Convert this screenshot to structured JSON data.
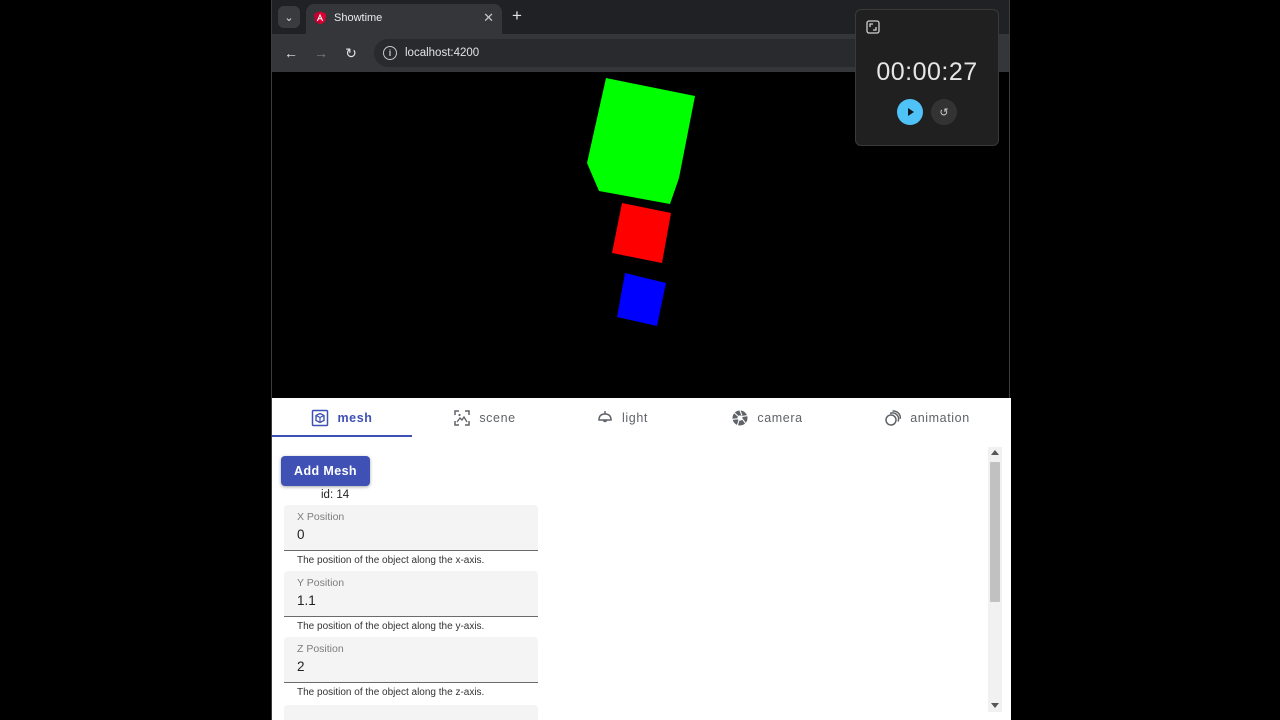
{
  "browser": {
    "tab_title": "Showtime",
    "tab_close": "✕",
    "new_tab": "+",
    "tab_menu": "⌄",
    "url": "localhost:4200",
    "back": "←",
    "forward": "→",
    "reload": "↻",
    "site_info": "i"
  },
  "scene": {
    "background": "#000000",
    "meshes": [
      {
        "color": "#00ff00",
        "name": "green-cube"
      },
      {
        "color": "#ff0000",
        "name": "red-cube"
      },
      {
        "color": "#0000ff",
        "name": "blue-cube"
      }
    ]
  },
  "panel": {
    "tabs": [
      {
        "label": "mesh",
        "icon": "cube-icon",
        "active": true
      },
      {
        "label": "scene",
        "icon": "image-frame-icon",
        "active": false
      },
      {
        "label": "light",
        "icon": "lamp-icon",
        "active": false
      },
      {
        "label": "camera",
        "icon": "camera-shutter-icon",
        "active": false
      },
      {
        "label": "animation",
        "icon": "animation-icon",
        "active": false
      }
    ],
    "accent": "#3f51b5",
    "add_mesh_label": "Add Mesh",
    "mesh_id": "id: 14",
    "fields": [
      {
        "label": "X Position",
        "value": "0",
        "hint": "The position of the object along the x-axis."
      },
      {
        "label": "Y Position",
        "value": "1.1",
        "hint": "The position of the object along the y-axis."
      },
      {
        "label": "Z Position",
        "value": "2",
        "hint": "The position of the object along the z-axis."
      }
    ],
    "check": "✓"
  },
  "timer": {
    "display": "00:00:27",
    "reset": "↺",
    "play_color": "#4fc3f7"
  }
}
